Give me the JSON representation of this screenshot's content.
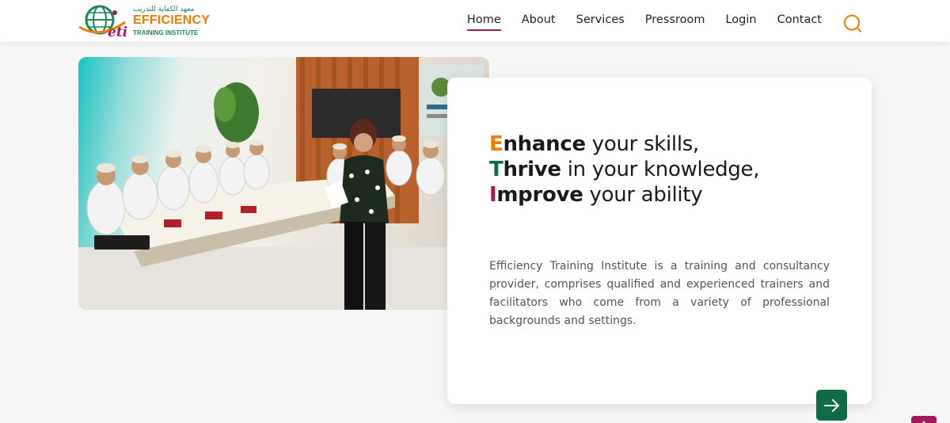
{
  "brand": {
    "arabic_name": "معهد الكفاية للتدريب",
    "name": "EFFICIENCY",
    "subtitle": "TRAINING INSTITUTE",
    "monogram": "eti",
    "colors": {
      "orange": "#ef7d00",
      "green": "#0f6b45",
      "purple": "#a3195b"
    }
  },
  "nav": {
    "items": [
      {
        "label": "Home",
        "active": true
      },
      {
        "label": "About"
      },
      {
        "label": "Services"
      },
      {
        "label": "Pressroom"
      },
      {
        "label": "Login"
      },
      {
        "label": "Contact"
      }
    ],
    "search_icon": "search-icon"
  },
  "hero": {
    "lines": [
      {
        "initial": "E",
        "rest": "nhance",
        "tail": " your skills,"
      },
      {
        "initial": "T",
        "rest": "hrive",
        "tail": " in your knowledge,"
      },
      {
        "initial": "I",
        "rest": "mprove",
        "tail": " your ability"
      }
    ],
    "description": "Efficiency Training Institute is a training and consultancy provider, comprises qualified and experienced trainers and facilitators who come from a variety of professional backgrounds and settings.",
    "arrow_icon": "arrow-right-icon"
  },
  "scroll_top_icon": "chevron-up-icon"
}
